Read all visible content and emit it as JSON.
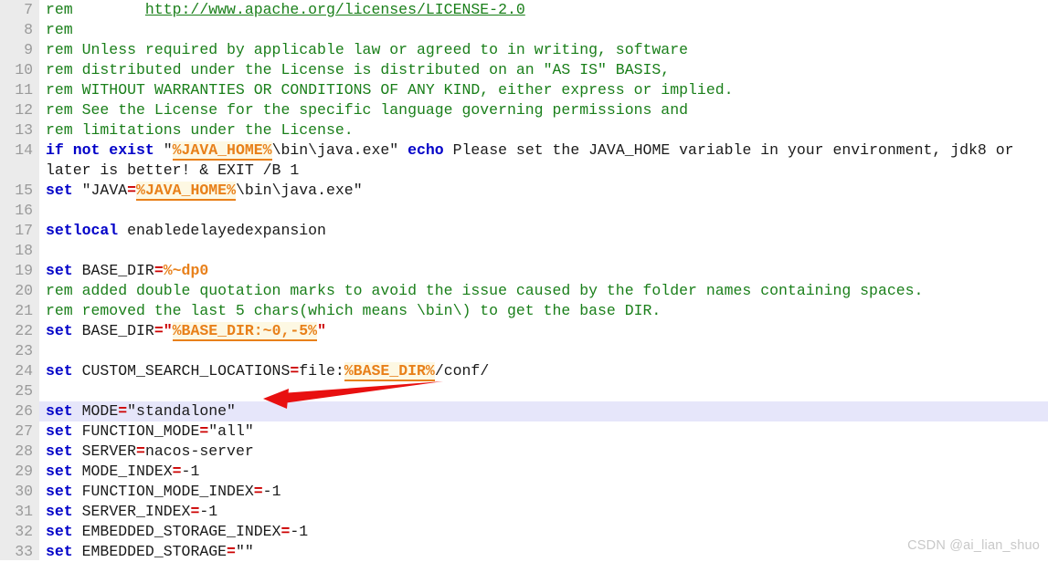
{
  "editor": {
    "name": "code-editor",
    "language": "bat",
    "gutter_background": "#ebebeb",
    "background": "#ffffff",
    "current_line_number": 26,
    "current_line_highlight": "#e6e6fa",
    "first_visible_line": 7,
    "last_visible_line": 33,
    "colors": {
      "comment": "#1a7f1a",
      "keyword": "#0000c8",
      "operator": "#cc0000",
      "variable": "#e8801a",
      "variable_highlight_bg": "#fdf8e3",
      "line_number": "#9a9a9a",
      "text": "#000000"
    }
  },
  "annotation": {
    "name": "red-arrow",
    "color": "#e81010",
    "points_to_line": 26,
    "points_to_text": "set MODE=\"standalone\"",
    "direction": "left"
  },
  "watermark": {
    "text": "CSDN @ai_lian_shuo",
    "color": "#c8c8c8"
  },
  "lines": [
    {
      "number": "7",
      "current": false,
      "tokens": [
        {
          "t": "rem        ",
          "c": "comment"
        },
        {
          "t": "http://www.apache.org/licenses/LICENSE-2.0",
          "c": "link"
        }
      ]
    },
    {
      "number": "8",
      "current": false,
      "tokens": [
        {
          "t": "rem",
          "c": "comment"
        }
      ]
    },
    {
      "number": "9",
      "current": false,
      "tokens": [
        {
          "t": "rem Unless required by applicable law or agreed to in writing, software",
          "c": "comment"
        }
      ]
    },
    {
      "number": "10",
      "current": false,
      "tokens": [
        {
          "t": "rem distributed under the License is distributed on an \"AS IS\" BASIS,",
          "c": "comment"
        }
      ]
    },
    {
      "number": "11",
      "current": false,
      "tokens": [
        {
          "t": "rem WITHOUT WARRANTIES OR CONDITIONS OF ANY KIND, either express or implied.",
          "c": "comment"
        }
      ]
    },
    {
      "number": "12",
      "current": false,
      "tokens": [
        {
          "t": "rem See the License for the specific language governing permissions and",
          "c": "comment"
        }
      ]
    },
    {
      "number": "13",
      "current": false,
      "tokens": [
        {
          "t": "rem limitations under the License.",
          "c": "comment"
        }
      ]
    },
    {
      "number": "14",
      "current": false,
      "tokens": [
        {
          "t": "if not exist",
          "c": "kw"
        },
        {
          "t": " \"",
          "c": "plain"
        },
        {
          "t": "%JAVA_HOME%",
          "c": "var"
        },
        {
          "t": "\\bin\\java.exe\" ",
          "c": "plain"
        },
        {
          "t": "echo",
          "c": "kw"
        },
        {
          "t": " Please set the JAVA_HOME variable in your environment, jdk8 or later is better! & EXIT /B 1",
          "c": "plain"
        }
      ]
    },
    {
      "number": "15",
      "current": false,
      "tokens": [
        {
          "t": "set",
          "c": "kw"
        },
        {
          "t": " \"JAVA",
          "c": "plain"
        },
        {
          "t": "=",
          "c": "op"
        },
        {
          "t": "%JAVA_HOME%",
          "c": "var"
        },
        {
          "t": "\\bin\\java.exe\"",
          "c": "plain"
        }
      ]
    },
    {
      "number": "16",
      "current": false,
      "tokens": []
    },
    {
      "number": "17",
      "current": false,
      "tokens": [
        {
          "t": "setlocal",
          "c": "kw"
        },
        {
          "t": " enabledelayedexpansion",
          "c": "plain"
        }
      ]
    },
    {
      "number": "18",
      "current": false,
      "tokens": []
    },
    {
      "number": "19",
      "current": false,
      "tokens": [
        {
          "t": "set",
          "c": "kw"
        },
        {
          "t": " BASE_DIR",
          "c": "plain"
        },
        {
          "t": "=",
          "c": "op"
        },
        {
          "t": "%~dp0",
          "c": "var-plain"
        }
      ]
    },
    {
      "number": "20",
      "current": false,
      "tokens": [
        {
          "t": "rem added double quotation marks to avoid the issue caused by the folder names containing spaces.",
          "c": "comment"
        }
      ]
    },
    {
      "number": "21",
      "current": false,
      "tokens": [
        {
          "t": "rem removed the last 5 chars(which means \\bin\\) to get the base DIR.",
          "c": "comment"
        }
      ]
    },
    {
      "number": "22",
      "current": false,
      "tokens": [
        {
          "t": "set",
          "c": "kw"
        },
        {
          "t": " BASE_DIR",
          "c": "plain"
        },
        {
          "t": "=\"",
          "c": "op"
        },
        {
          "t": "%BASE_DIR:~0,-5%",
          "c": "var"
        },
        {
          "t": "\"",
          "c": "op"
        }
      ]
    },
    {
      "number": "23",
      "current": false,
      "tokens": []
    },
    {
      "number": "24",
      "current": false,
      "tokens": [
        {
          "t": "set",
          "c": "kw"
        },
        {
          "t": " CUSTOM_SEARCH_LOCATIONS",
          "c": "plain"
        },
        {
          "t": "=",
          "c": "op"
        },
        {
          "t": "file:",
          "c": "plain"
        },
        {
          "t": "%BASE_DIR%",
          "c": "var"
        },
        {
          "t": "/conf/",
          "c": "plain"
        }
      ]
    },
    {
      "number": "25",
      "current": false,
      "tokens": []
    },
    {
      "number": "26",
      "current": true,
      "tokens": [
        {
          "t": "set",
          "c": "kw"
        },
        {
          "t": " MODE",
          "c": "plain"
        },
        {
          "t": "=",
          "c": "op"
        },
        {
          "t": "\"standalone\"",
          "c": "plain"
        }
      ]
    },
    {
      "number": "27",
      "current": false,
      "tokens": [
        {
          "t": "set",
          "c": "kw"
        },
        {
          "t": " FUNCTION_MODE",
          "c": "plain"
        },
        {
          "t": "=",
          "c": "op"
        },
        {
          "t": "\"all\"",
          "c": "plain"
        }
      ]
    },
    {
      "number": "28",
      "current": false,
      "tokens": [
        {
          "t": "set",
          "c": "kw"
        },
        {
          "t": " SERVER",
          "c": "plain"
        },
        {
          "t": "=",
          "c": "op"
        },
        {
          "t": "nacos-server",
          "c": "plain"
        }
      ]
    },
    {
      "number": "29",
      "current": false,
      "tokens": [
        {
          "t": "set",
          "c": "kw"
        },
        {
          "t": " MODE_INDEX",
          "c": "plain"
        },
        {
          "t": "=",
          "c": "op"
        },
        {
          "t": "-1",
          "c": "plain"
        }
      ]
    },
    {
      "number": "30",
      "current": false,
      "tokens": [
        {
          "t": "set",
          "c": "kw"
        },
        {
          "t": " FUNCTION_MODE_INDEX",
          "c": "plain"
        },
        {
          "t": "=",
          "c": "op"
        },
        {
          "t": "-1",
          "c": "plain"
        }
      ]
    },
    {
      "number": "31",
      "current": false,
      "tokens": [
        {
          "t": "set",
          "c": "kw"
        },
        {
          "t": " SERVER_INDEX",
          "c": "plain"
        },
        {
          "t": "=",
          "c": "op"
        },
        {
          "t": "-1",
          "c": "plain"
        }
      ]
    },
    {
      "number": "32",
      "current": false,
      "tokens": [
        {
          "t": "set",
          "c": "kw"
        },
        {
          "t": " EMBEDDED_STORAGE_INDEX",
          "c": "plain"
        },
        {
          "t": "=",
          "c": "op"
        },
        {
          "t": "-1",
          "c": "plain"
        }
      ]
    },
    {
      "number": "33",
      "current": false,
      "tokens": [
        {
          "t": "set",
          "c": "kw"
        },
        {
          "t": " EMBEDDED_STORAGE",
          "c": "plain"
        },
        {
          "t": "=",
          "c": "op"
        },
        {
          "t": "\"\"",
          "c": "plain"
        }
      ]
    }
  ]
}
